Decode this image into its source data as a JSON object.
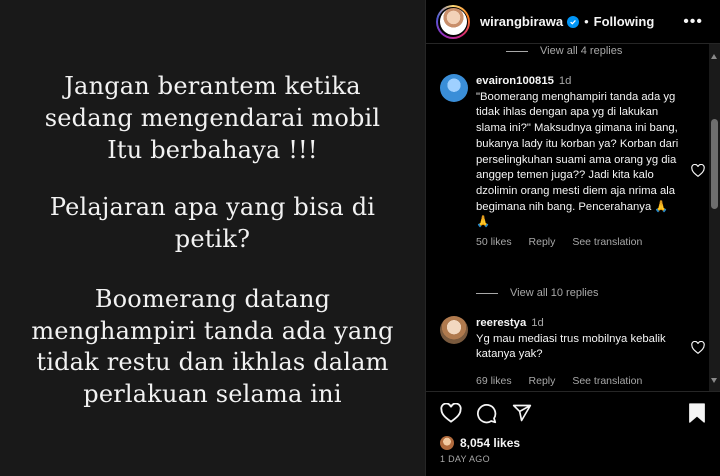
{
  "post_image": {
    "paragraphs": [
      "Jangan berantem ketika\nsedang mengendarai mobil\nItu berbahaya !!!",
      "Pelajaran apa yang bisa di\npetik?",
      "Boomerang datang\nmenghampiri tanda ada yang\ntidak restu dan ikhlas dalam\nperlakuan selama ini"
    ]
  },
  "header": {
    "username": "wirangbirawa",
    "dot": "•",
    "follow_status": "Following",
    "more": "•••"
  },
  "view_replies_top": "View all 4 replies",
  "comments": [
    {
      "username": "evairon100815",
      "time": "1d",
      "text": "\"Boomerang menghampiri tanda ada yg tidak ihlas dengan apa yg di lakukan slama ini?\" Maksudnya gimana ini bang, bukanya lady itu korban ya? Korban dari perselingkuhan suami ama orang yg dia anggep temen juga?? Jadi kita kalo dzolimin orang mesti diem aja nrima ala begimana nih bang. Pencerahanya 🙏🙏",
      "likes": "50 likes",
      "reply": "Reply",
      "translate": "See translation",
      "view_replies": "View all 10 replies",
      "avatar_color": "#3a8ed8"
    },
    {
      "username": "reerestya",
      "time": "1d",
      "text": "Yg mau mediasi trus mobilnya kebalik katanya yak?",
      "likes": "69 likes",
      "reply": "Reply",
      "translate": "See translation",
      "avatar_color": "#c9a27a"
    }
  ],
  "actions": {
    "likes": "8,054 likes",
    "date": "1 DAY AGO"
  },
  "icons": {
    "like": "heart-icon",
    "comment": "comment-icon",
    "share": "share-icon",
    "save": "bookmark-icon"
  }
}
